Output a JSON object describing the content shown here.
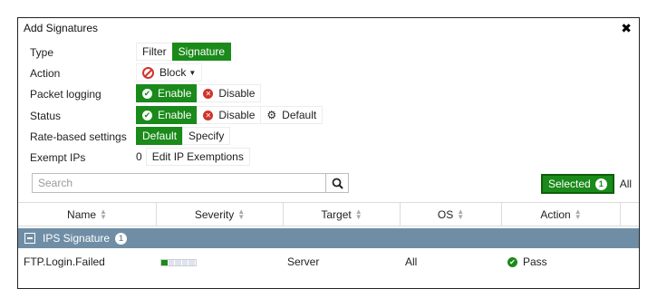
{
  "dialog": {
    "title": "Add Signatures",
    "close_icon": "close-icon"
  },
  "form": {
    "type": {
      "label": "Type",
      "options": [
        "Filter",
        "Signature"
      ],
      "selected": "Signature"
    },
    "action": {
      "label": "Action",
      "value": "Block",
      "icon": "block-icon"
    },
    "packet_logging": {
      "label": "Packet logging",
      "enable": "Enable",
      "disable": "Disable",
      "selected": "Enable"
    },
    "status": {
      "label": "Status",
      "enable": "Enable",
      "disable": "Disable",
      "default": "Default",
      "selected": "Enable"
    },
    "rate_based": {
      "label": "Rate-based settings",
      "default": "Default",
      "specify": "Specify",
      "selected": "Default"
    },
    "exempt_ips": {
      "label": "Exempt IPs",
      "count": "0",
      "button": "Edit IP Exemptions"
    }
  },
  "search": {
    "placeholder": "Search",
    "icon": "search-icon"
  },
  "view_toggle": {
    "selected_label": "Selected",
    "selected_count": "1",
    "all_label": "All"
  },
  "table": {
    "columns": [
      "Name",
      "Severity",
      "Target",
      "OS",
      "Action"
    ],
    "group": {
      "label": "IPS Signature",
      "count": "1"
    },
    "rows": [
      {
        "name": "FTP.Login.Failed",
        "severity_level": 1,
        "severity_max": 5,
        "target": "Server",
        "os": "All",
        "action": "Pass"
      }
    ]
  },
  "colors": {
    "accent_green": "#1a8a1a",
    "group_header": "#6f8ea5",
    "disable_red": "#d0342c"
  }
}
